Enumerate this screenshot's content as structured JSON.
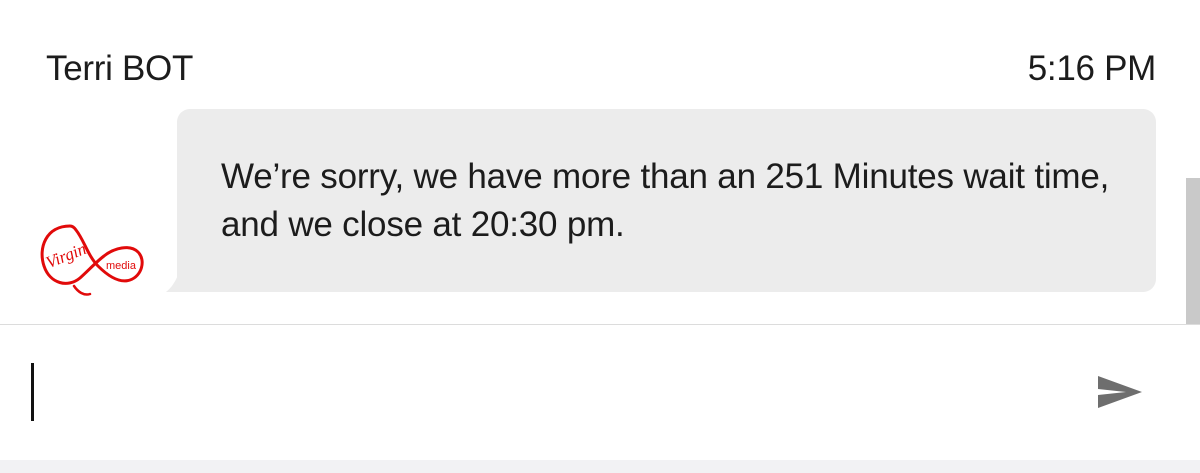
{
  "message": {
    "sender": "Terri BOT",
    "time": "5:16 PM",
    "text": "We’re sorry, we have more than an 251 Minutes wait time, and we close at 20:30 pm."
  },
  "avatar": {
    "icon": "virgin-media-logo",
    "logo_text_primary": "Virgin",
    "logo_text_secondary": "media",
    "brand_color": "#e10a0a"
  },
  "composer": {
    "value": "",
    "placeholder": "",
    "send_icon": "send-arrow-icon"
  },
  "colors": {
    "bubble": "#ececec",
    "text": "#1c1c1c",
    "send_icon": "#6e6e6e"
  }
}
